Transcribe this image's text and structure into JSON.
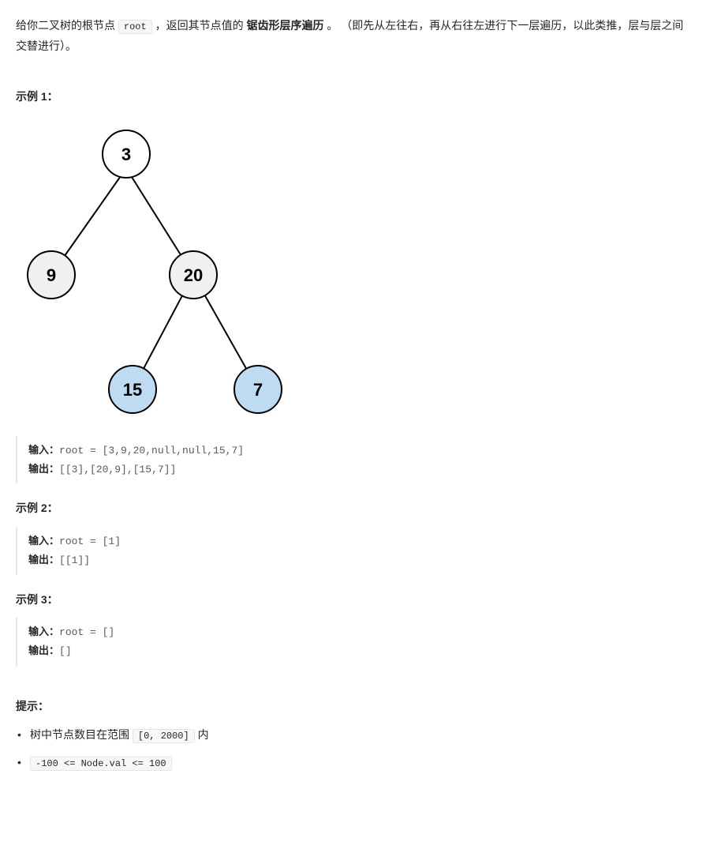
{
  "desc": {
    "pre": "给你二叉树的根节点 ",
    "code": "root",
    "mid": " ，返回其节点值的 ",
    "bold": "锯齿形层序遍历",
    "post": " 。 （即先从左往右，再从右往左进行下一层遍历，以此类推，层与层之间交替进行）。"
  },
  "tree": {
    "n3": "3",
    "n9": "9",
    "n20": "20",
    "n15": "15",
    "n7": "7"
  },
  "example1": {
    "title": "示例 1：",
    "input_label": "输入：",
    "input_value": "root = [3,9,20,null,null,15,7]",
    "output_label": "输出：",
    "output_value": "[[3],[20,9],[15,7]]"
  },
  "example2": {
    "title": "示例 2：",
    "input_label": "输入：",
    "input_value": "root = [1]",
    "output_label": "输出：",
    "output_value": "[[1]]"
  },
  "example3": {
    "title": "示例 3：",
    "input_label": "输入：",
    "input_value": "root = []",
    "output_label": "输出：",
    "output_value": "[]"
  },
  "constraints": {
    "title": "提示：",
    "item1_pre": "树中节点数目在范围 ",
    "item1_code": "[0, 2000]",
    "item1_post": " 内",
    "item2_code": "-100 <= Node.val <= 100"
  }
}
